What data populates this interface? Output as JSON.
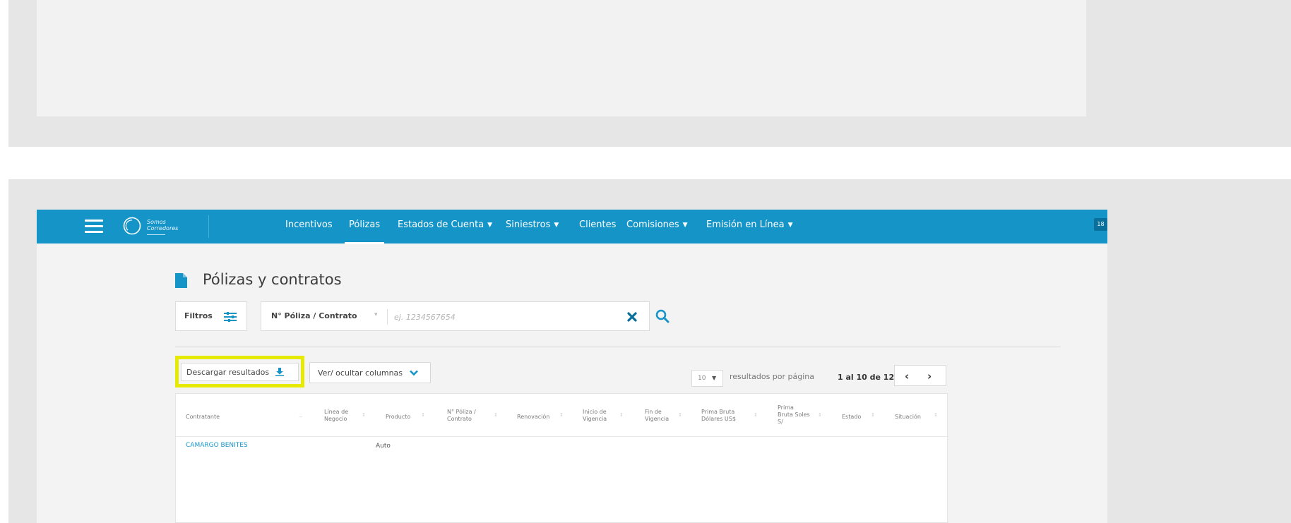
{
  "colors": {
    "brand": "#1594c8",
    "highlight": "#e6ea00",
    "frame_gray": "#e6e6e6",
    "link": "#1594c8"
  },
  "navbar": {
    "brand_line1": "Somos",
    "brand_line2": "Corredores",
    "items": [
      {
        "label": "Incentivos",
        "dropdown": false
      },
      {
        "label": "Pólizas",
        "dropdown": false,
        "active": true
      },
      {
        "label": "Estados de Cuenta",
        "dropdown": true
      },
      {
        "label": "Siniestros",
        "dropdown": true
      },
      {
        "label": "Clientes",
        "dropdown": false
      },
      {
        "label": "Comisiones",
        "dropdown": true
      },
      {
        "label": "Emisión en Línea",
        "dropdown": true
      }
    ],
    "badge": "18",
    "icons": [
      "menu-icon",
      "brand-logo-icon"
    ]
  },
  "page": {
    "title": "Pólizas y contratos",
    "title_icon": "document-icon"
  },
  "search": {
    "filters_label": "Filtros",
    "type_label": "N° Póliza / Contrato",
    "placeholder": "ej. 1234567654",
    "value": ""
  },
  "toolbar": {
    "download_label": "Descargar resultados",
    "columns_label": "Ver/ ocultar columnas",
    "per_page_value": "10",
    "per_page_label": "resultados por página",
    "page_info": "1 al 10 de 12",
    "prev": "‹",
    "next": "›"
  },
  "table": {
    "headers": [
      [
        "Contratante"
      ],
      [
        "Línea de",
        "Negocio"
      ],
      [
        "Producto"
      ],
      [
        "N° Póliza /",
        "Contrato"
      ],
      [
        "Renovación"
      ],
      [
        "Inicio de",
        "Vigencia"
      ],
      [
        "Fin de",
        "Vigencia"
      ],
      [
        "Prima Bruta",
        "Dólares US$"
      ],
      [
        "Prima",
        "Bruta Soles",
        "S/"
      ],
      [
        "Estado"
      ],
      [
        "Situación"
      ]
    ],
    "rows": [
      {
        "contratante": "CAMARGO BENITES",
        "producto": "Auto"
      }
    ]
  }
}
